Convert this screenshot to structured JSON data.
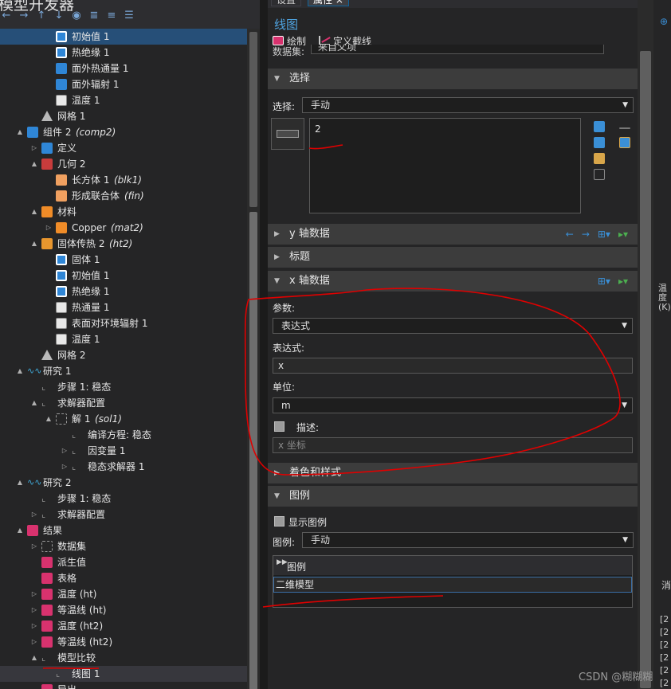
{
  "tree": {
    "title": "模型开发器",
    "toolbar_icons": [
      "back-arrow-icon",
      "forward-arrow-icon",
      "move-up-icon",
      "move-down-icon",
      "show-icon",
      "collapse-all-icon",
      "expand-all-icon",
      "list-icon"
    ],
    "rows": [
      {
        "label": "初始值 1",
        "tag": "",
        "level": 4,
        "arrow": "",
        "icon": "i-bluew",
        "sel": true
      },
      {
        "label": "热绝缘 1",
        "tag": "",
        "level": 4,
        "arrow": "",
        "icon": "i-bluew",
        "sel": false
      },
      {
        "label": "面外热通量 1",
        "tag": "",
        "level": 4,
        "arrow": "",
        "icon": "i-blue",
        "sel": false
      },
      {
        "label": "面外辐射 1",
        "tag": "",
        "level": 4,
        "arrow": "",
        "icon": "i-blue",
        "sel": false
      },
      {
        "label": "温度 1",
        "tag": "",
        "level": 4,
        "arrow": "",
        "icon": "i-white",
        "sel": false
      },
      {
        "label": "网格 1",
        "tag": "",
        "level": 3,
        "arrow": "",
        "icon": "i-tri",
        "sel": false
      },
      {
        "label": "组件 2",
        "tag": "(comp2)",
        "level": 2,
        "arrow": "▲",
        "icon": "i-blue",
        "sel": false
      },
      {
        "label": "定义",
        "tag": "",
        "level": 3,
        "arrow": "▷",
        "icon": "i-blue",
        "sel": false
      },
      {
        "label": "几何 2",
        "tag": "",
        "level": 3,
        "arrow": "▲",
        "icon": "i-red",
        "sel": false
      },
      {
        "label": "长方体 1",
        "tag": "(blk1)",
        "level": 4,
        "arrow": "",
        "icon": "i-cube",
        "sel": false
      },
      {
        "label": "形成联合体",
        "tag": "(fin)",
        "level": 4,
        "arrow": "",
        "icon": "i-cube",
        "sel": false
      },
      {
        "label": "材料",
        "tag": "",
        "level": 3,
        "arrow": "▲",
        "icon": "i-mat",
        "sel": false
      },
      {
        "label": "Copper",
        "tag": "(mat2)",
        "level": 4,
        "arrow": "▷",
        "icon": "i-mat",
        "sel": false
      },
      {
        "label": "固体传热 2",
        "tag": "(ht2)",
        "level": 3,
        "arrow": "▲",
        "icon": "i-orange",
        "sel": false
      },
      {
        "label": "固体 1",
        "tag": "",
        "level": 4,
        "arrow": "",
        "icon": "i-bluew",
        "sel": false
      },
      {
        "label": "初始值 1",
        "tag": "",
        "level": 4,
        "arrow": "",
        "icon": "i-bluew",
        "sel": false
      },
      {
        "label": "热绝缘 1",
        "tag": "",
        "level": 4,
        "arrow": "",
        "icon": "i-bluew",
        "sel": false
      },
      {
        "label": "热通量 1",
        "tag": "",
        "level": 4,
        "arrow": "",
        "icon": "i-white",
        "sel": false
      },
      {
        "label": "表面对环境辐射 1",
        "tag": "",
        "level": 4,
        "arrow": "",
        "icon": "i-white",
        "sel": false
      },
      {
        "label": "温度 1",
        "tag": "",
        "level": 4,
        "arrow": "",
        "icon": "i-white",
        "sel": false
      },
      {
        "label": "网格 2",
        "tag": "",
        "level": 3,
        "arrow": "",
        "icon": "i-tri",
        "sel": false
      },
      {
        "label": "研究 1",
        "tag": "",
        "level": 2,
        "arrow": "▲",
        "icon": "i-study",
        "sel": false
      },
      {
        "label": "步骤 1: 稳态",
        "tag": "",
        "level": 3,
        "arrow": "",
        "icon": "i-line",
        "sel": false
      },
      {
        "label": "求解器配置",
        "tag": "",
        "level": 3,
        "arrow": "▲",
        "icon": "i-line",
        "sel": false
      },
      {
        "label": "解 1",
        "tag": "(sol1)",
        "level": 4,
        "arrow": "▲",
        "icon": "i-grid",
        "sel": false
      },
      {
        "label": "编译方程: 稳态",
        "tag": "",
        "level": 5,
        "arrow": "",
        "icon": "i-line",
        "sel": false
      },
      {
        "label": "因变量 1",
        "tag": "",
        "level": 5,
        "arrow": "▷",
        "icon": "i-line",
        "sel": false
      },
      {
        "label": "稳态求解器 1",
        "tag": "",
        "level": 5,
        "arrow": "▷",
        "icon": "i-line",
        "sel": false
      },
      {
        "label": "研究 2",
        "tag": "",
        "level": 2,
        "arrow": "▲",
        "icon": "i-study",
        "sel": false
      },
      {
        "label": "步骤 1: 稳态",
        "tag": "",
        "level": 3,
        "arrow": "",
        "icon": "i-line",
        "sel": false
      },
      {
        "label": "求解器配置",
        "tag": "",
        "level": 3,
        "arrow": "▷",
        "icon": "i-line",
        "sel": false
      },
      {
        "label": "结果",
        "tag": "",
        "level": 2,
        "arrow": "▲",
        "icon": "i-pink",
        "sel": false
      },
      {
        "label": "数据集",
        "tag": "",
        "level": 3,
        "arrow": "▷",
        "icon": "i-grid",
        "sel": false
      },
      {
        "label": "派生值",
        "tag": "",
        "level": 3,
        "arrow": "",
        "icon": "i-pink",
        "sel": false
      },
      {
        "label": "表格",
        "tag": "",
        "level": 3,
        "arrow": "",
        "icon": "i-pink",
        "sel": false
      },
      {
        "label": "温度 (ht)",
        "tag": "",
        "level": 3,
        "arrow": "▷",
        "icon": "i-pink",
        "sel": false
      },
      {
        "label": "等温线 (ht)",
        "tag": "",
        "level": 3,
        "arrow": "▷",
        "icon": "i-pink",
        "sel": false
      },
      {
        "label": "温度 (ht2)",
        "tag": "",
        "level": 3,
        "arrow": "▷",
        "icon": "i-pink",
        "sel": false
      },
      {
        "label": "等温线 (ht2)",
        "tag": "",
        "level": 3,
        "arrow": "▷",
        "icon": "i-pink",
        "sel": false
      },
      {
        "label": "模型比较",
        "tag": "",
        "level": 3,
        "arrow": "▲",
        "icon": "i-line",
        "sel": false
      },
      {
        "label": "线图 1",
        "tag": "",
        "level": 4,
        "arrow": "",
        "icon": "i-line",
        "sel": "gray"
      },
      {
        "label": "导出",
        "tag": "",
        "level": 3,
        "arrow": "",
        "icon": "i-pink",
        "sel": false
      }
    ]
  },
  "settings": {
    "tabs": [
      "设置",
      "属性"
    ],
    "title": "线图",
    "toolbar": {
      "plot": "绘制",
      "define_cutline": "定义截线"
    },
    "dataset": {
      "label": "数据集:",
      "value": "来自父项"
    },
    "section_selection": {
      "title": "选择",
      "label": "选择:",
      "value": "手动",
      "list_value": "2"
    },
    "section_y": {
      "title": "y 轴数据"
    },
    "section_title": {
      "title": "标题"
    },
    "section_x": {
      "title": "x 轴数据",
      "param_label": "参数:",
      "param_value": "表达式",
      "expr_label": "表达式:",
      "expr_value": "x",
      "unit_label": "单位:",
      "unit_value": "m",
      "desc_label": "描述:",
      "desc_value": "x 坐标"
    },
    "section_coloring": {
      "title": "着色和样式"
    },
    "section_legend": {
      "title": "图例",
      "show_legend": "显示图例",
      "legend_label": "图例:",
      "legend_value": "手动",
      "table_header": "图例",
      "table_row": "二维模型"
    }
  },
  "right_strip": {
    "vertical_label": "温度 (K)",
    "panel_label": "消",
    "log_lines": [
      "[2",
      "[2",
      "[2",
      "[2",
      "[2",
      "[2"
    ]
  },
  "watermark": "CSDN @糊糊糊"
}
